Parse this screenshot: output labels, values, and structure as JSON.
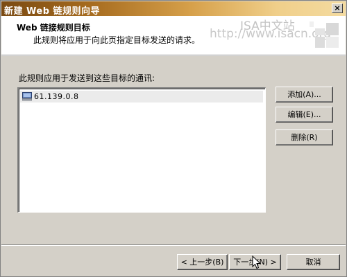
{
  "window": {
    "title": "新建 Web 链规则向导",
    "close_label": "×"
  },
  "header": {
    "title": "Web 链接规则目标",
    "subtitle": "此规则将应用于向此页指定目标发送的请求。",
    "watermark_line1": "ISA中文站",
    "watermark_line2": "http://www.isacn.org"
  },
  "body": {
    "instruction": "此规则应用于发送到这些目标的通讯:",
    "destinations": [
      {
        "label": "61.139.0.8",
        "icon": "computer-icon",
        "selected": true
      }
    ],
    "buttons": {
      "add": "添加(A)...",
      "edit": "编辑(E)...",
      "remove": "删除(R)"
    }
  },
  "footer": {
    "back": "< 上一步(B)",
    "next": "下一步(N) >",
    "cancel": "取消"
  },
  "colors": {
    "titlebar_start": "#7a4a12",
    "titlebar_end": "#f4dba0",
    "dialog_bg": "#d4d0c8",
    "selected_row": "#ebebeb"
  }
}
